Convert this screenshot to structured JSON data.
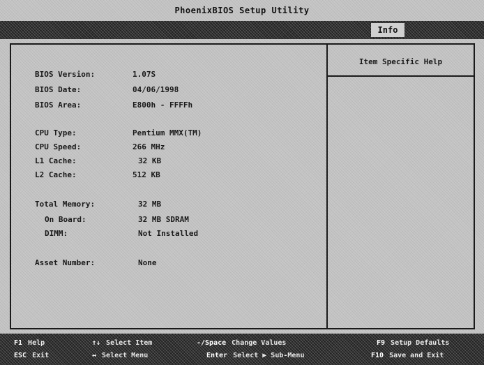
{
  "title": "PhoenixBIOS Setup Utility",
  "menu": {
    "active_tab": "Info"
  },
  "info": {
    "bios_version": {
      "label": "BIOS Version:",
      "value": "1.07S"
    },
    "bios_date": {
      "label": "BIOS Date:",
      "value": "04/06/1998"
    },
    "bios_area": {
      "label": "BIOS Area:",
      "value": "E800h - FFFFh"
    },
    "cpu_type": {
      "label": "CPU Type:",
      "value": "Pentium MMX(TM)"
    },
    "cpu_speed": {
      "label": "CPU Speed:",
      "value": "266 MHz"
    },
    "l1_cache": {
      "label": "L1 Cache:",
      "value": "32 KB"
    },
    "l2_cache": {
      "label": "L2 Cache:",
      "value": "512 KB"
    },
    "total_memory": {
      "label": "Total Memory:",
      "value": "32 MB"
    },
    "on_board": {
      "label": "On Board:",
      "value": "32 MB SDRAM"
    },
    "dimm": {
      "label": "DIMM:",
      "value": "Not Installed"
    },
    "asset_number": {
      "label": "Asset Number:",
      "value": "None"
    }
  },
  "help": {
    "title": "Item Specific Help"
  },
  "footer": {
    "f1": {
      "key": "F1",
      "desc": "Help"
    },
    "esc": {
      "key": "ESC",
      "desc": "Exit"
    },
    "updown": {
      "key": "↑↓",
      "desc": "Select Item"
    },
    "leftright": {
      "key": "↔",
      "desc": "Select Menu"
    },
    "minus_space": {
      "key": "-/Space",
      "desc": "Change Values"
    },
    "enter": {
      "key": "Enter",
      "desc": "Select ▶ Sub-Menu"
    },
    "f9": {
      "key": "F9",
      "desc": "Setup Defaults"
    },
    "f10": {
      "key": "F10",
      "desc": "Save and Exit"
    }
  }
}
